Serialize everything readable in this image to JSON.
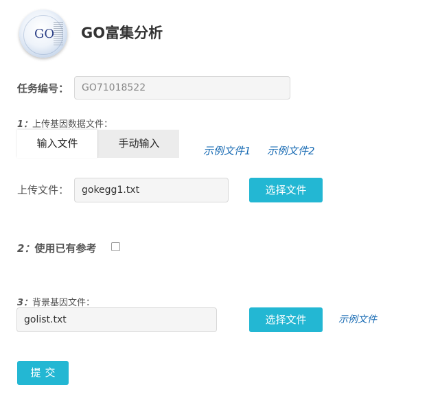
{
  "header": {
    "logo_text": "GO",
    "title": "GO富集分析"
  },
  "task": {
    "label": "任务编号：",
    "value": "GO71018522"
  },
  "section1": {
    "number": "1：",
    "label": "上传基因数据文件：",
    "tabs": [
      {
        "label": "输入文件",
        "active": true
      },
      {
        "label": "手动输入",
        "active": false
      }
    ],
    "example_links": [
      "示例文件1",
      "示例文件2"
    ],
    "upload_label": "上传文件：",
    "upload_value": "gokegg1.txt",
    "choose_button": "选择文件"
  },
  "section2": {
    "number": "2：",
    "label": "使用已有参考",
    "checked": false
  },
  "section3": {
    "number": "3：",
    "label": "背景基因文件：",
    "file_value": "golist.txt",
    "choose_button": "选择文件",
    "example_link": "示例文件"
  },
  "submit": {
    "label": "提交"
  },
  "colors": {
    "accent": "#23b7d3",
    "link": "#1a6cb4",
    "input_bg": "#f5f5f5"
  }
}
